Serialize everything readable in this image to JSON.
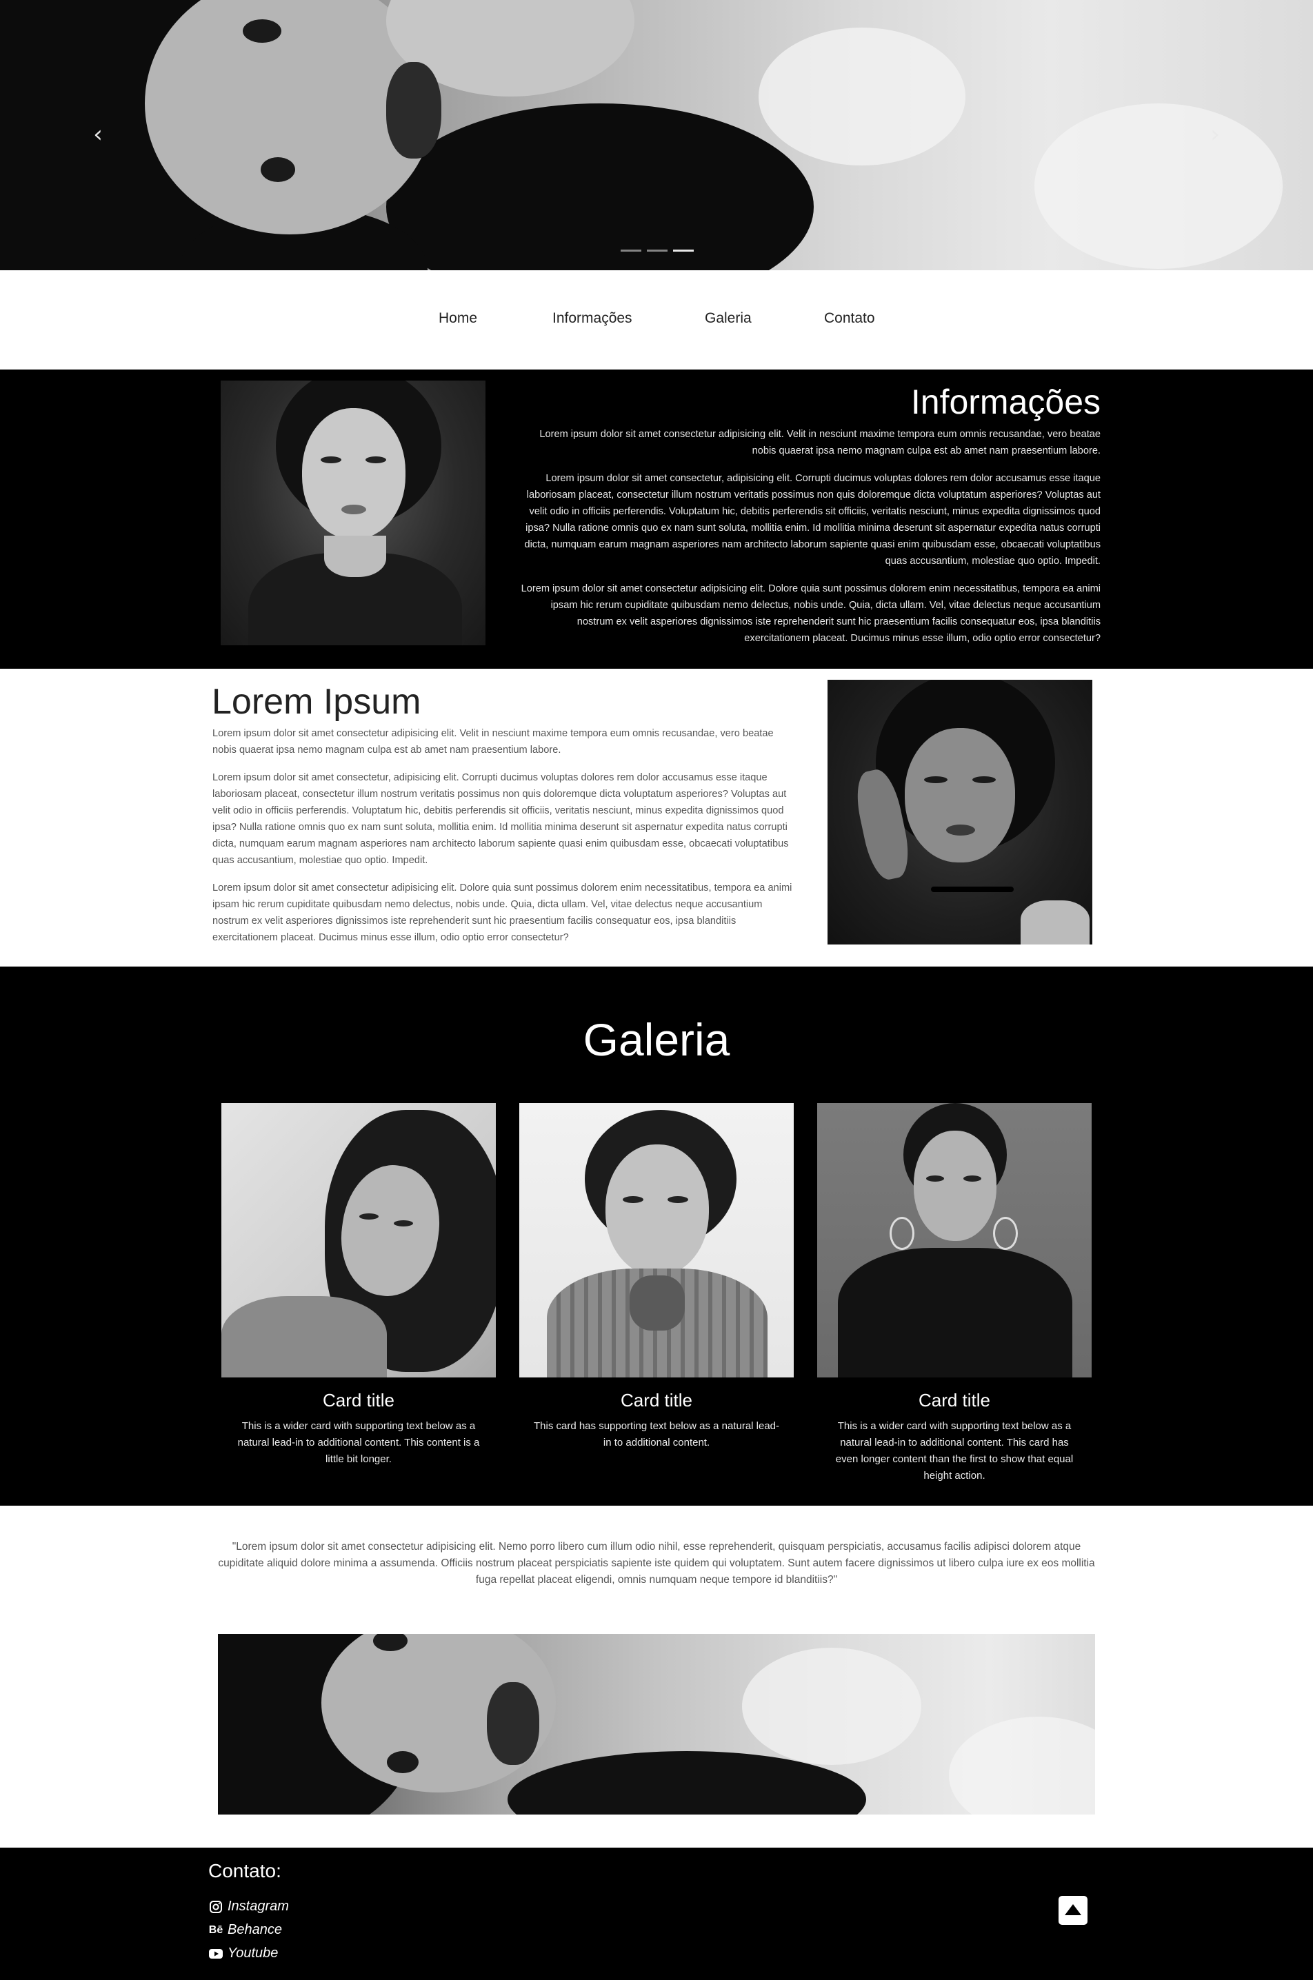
{
  "hero": {
    "prev_icon": "chevron-left-icon",
    "next_icon": "chevron-right-icon",
    "slides": 3,
    "active_slide": 3
  },
  "nav": {
    "items": [
      {
        "label": "Home"
      },
      {
        "label": "Informações"
      },
      {
        "label": "Galeria"
      },
      {
        "label": "Contato"
      }
    ]
  },
  "info": {
    "title": "Informações",
    "paragraphs": [
      "Lorem ipsum dolor sit amet consectetur adipisicing elit. Velit in nesciunt maxime tempora eum omnis recusandae, vero beatae nobis quaerat ipsa nemo magnam culpa est ab amet nam praesentium labore.",
      "Lorem ipsum dolor sit amet consectetur, adipisicing elit. Corrupti ducimus voluptas dolores rem dolor accusamus esse itaque laboriosam placeat, consectetur illum nostrum veritatis possimus non quis doloremque dicta voluptatum asperiores? Voluptas aut velit odio in officiis perferendis. Voluptatum hic, debitis perferendis sit officiis, veritatis nesciunt, minus expedita dignissimos quod ipsa? Nulla ratione omnis quo ex nam sunt soluta, mollitia enim. Id mollitia minima deserunt sit aspernatur expedita natus corrupti dicta, numquam earum magnam asperiores nam architecto laborum sapiente quasi enim quibusdam esse, obcaecati voluptatibus quas accusantium, molestiae quo optio. Impedit.",
      "Lorem ipsum dolor sit amet consectetur adipisicing elit. Dolore quia sunt possimus dolorem enim necessitatibus, tempora ea animi ipsam hic rerum cupiditate quibusdam nemo delectus, nobis unde. Quia, dicta ullam. Vel, vitae delectus neque accusantium nostrum ex velit asperiores dignissimos iste reprehenderit sunt hic praesentium facilis consequatur eos, ipsa blanditiis exercitationem placeat. Ducimus minus esse illum, odio optio error consectetur?"
    ]
  },
  "lorem": {
    "title": "Lorem Ipsum",
    "paragraphs": [
      "Lorem ipsum dolor sit amet consectetur adipisicing elit. Velit in nesciunt maxime tempora eum omnis recusandae, vero beatae nobis quaerat ipsa nemo magnam culpa est ab amet nam praesentium labore.",
      "Lorem ipsum dolor sit amet consectetur, adipisicing elit. Corrupti ducimus voluptas dolores rem dolor accusamus esse itaque laboriosam placeat, consectetur illum nostrum veritatis possimus non quis doloremque dicta voluptatum asperiores? Voluptas aut velit odio in officiis perferendis. Voluptatum hic, debitis perferendis sit officiis, veritatis nesciunt, minus expedita dignissimos quod ipsa? Nulla ratione omnis quo ex nam sunt soluta, mollitia enim. Id mollitia minima deserunt sit aspernatur expedita natus corrupti dicta, numquam earum magnam asperiores nam architecto laborum sapiente quasi enim quibusdam esse, obcaecati voluptatibus quas accusantium, molestiae quo optio. Impedit.",
      "Lorem ipsum dolor sit amet consectetur adipisicing elit. Dolore quia sunt possimus dolorem enim necessitatibus, tempora ea animi ipsam hic rerum cupiditate quibusdam nemo delectus, nobis unde. Quia, dicta ullam. Vel, vitae delectus neque accusantium nostrum ex velit asperiores dignissimos iste reprehenderit sunt hic praesentium facilis consequatur eos, ipsa blanditiis exercitationem placeat. Ducimus minus esse illum, odio optio error consectetur?"
    ]
  },
  "galeria": {
    "title": "Galeria",
    "cards": [
      {
        "title": "Card title",
        "text": "This is a wider card with supporting text below as a natural lead-in to additional content. This content is a little bit longer."
      },
      {
        "title": "Card title",
        "text": "This card has supporting text below as a natural lead-in to additional content."
      },
      {
        "title": "Card title",
        "text": "This is a wider card with supporting text below as a natural lead-in to additional content. This card has even longer content than the first to show that equal height action."
      }
    ]
  },
  "quote": {
    "text": "\"Lorem ipsum dolor sit amet consectetur adipisicing elit. Nemo porro libero cum illum odio nihil, esse reprehenderit, quisquam perspiciatis, accusamus facilis adipisci dolorem atque cupiditate aliquid dolore minima a assumenda. Officiis nostrum placeat perspiciatis sapiente iste quidem qui voluptatem. Sunt autem facere dignissimos ut libero culpa iure ex eos mollitia fuga repellat placeat eligendi, omnis numquam neque tempore id blanditiis?\""
  },
  "footer": {
    "title": "Contato:",
    "links": [
      {
        "label": "Instagram",
        "icon": "instagram-icon"
      },
      {
        "label": "Behance",
        "icon": "behance-icon"
      },
      {
        "label": "Youtube",
        "icon": "youtube-icon"
      }
    ],
    "back_to_top_icon": "arrow-up-icon"
  }
}
